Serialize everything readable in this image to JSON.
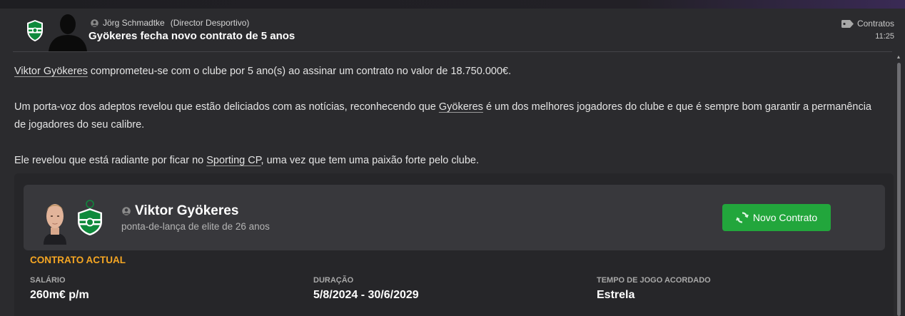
{
  "header": {
    "sender_name": "Jörg Schmadtke",
    "sender_role": "(Director Desportivo)",
    "subject": "Gyökeres fecha novo contrato de 5 anos",
    "category": "Contratos",
    "time": "11:25"
  },
  "body": {
    "p1": {
      "link": "Viktor Gyökeres",
      "text": " comprometeu-se com o clube por 5 ano(s) ao assinar um contrato no valor de 18.750.000€."
    },
    "p2": {
      "before": "Um porta-voz dos adeptos revelou que estão deliciados com as notícias, reconhecendo que ",
      "link": "Gyökeres",
      "after": " é um dos melhores jogadores do clube e que é sempre bom garantir a permanência de jogadores do seu calibre."
    },
    "p3": {
      "before": "Ele revelou que está radiante por ficar no ",
      "link": "Sporting CP",
      "after": ", uma vez que tem uma paixão forte pelo clube."
    }
  },
  "player_card": {
    "name": "Viktor Gyökeres",
    "description": "ponta-de-lança de elite de 26 anos",
    "button_label": "Novo Contrato"
  },
  "contract": {
    "section_title": "CONTRATO ACTUAL",
    "salary_label": "SALÁRIO",
    "salary_value": "260m€ p/m",
    "duration_label": "DURAÇÃO",
    "duration_value": "5/8/2024 - 30/6/2029",
    "playing_time_label": "TEMPO DE JOGO ACORDADO",
    "playing_time_value": "Estrela"
  },
  "icons": {
    "club_badge": "sporting-cp-badge-icon",
    "sender_avatar": "silhouette-avatar-icon",
    "person": "person-icon",
    "category": "tag-icon",
    "refresh": "refresh-icon"
  },
  "colors": {
    "accent_orange": "#f5a623",
    "button_green": "#22a63c",
    "background": "#2b2b2e"
  }
}
